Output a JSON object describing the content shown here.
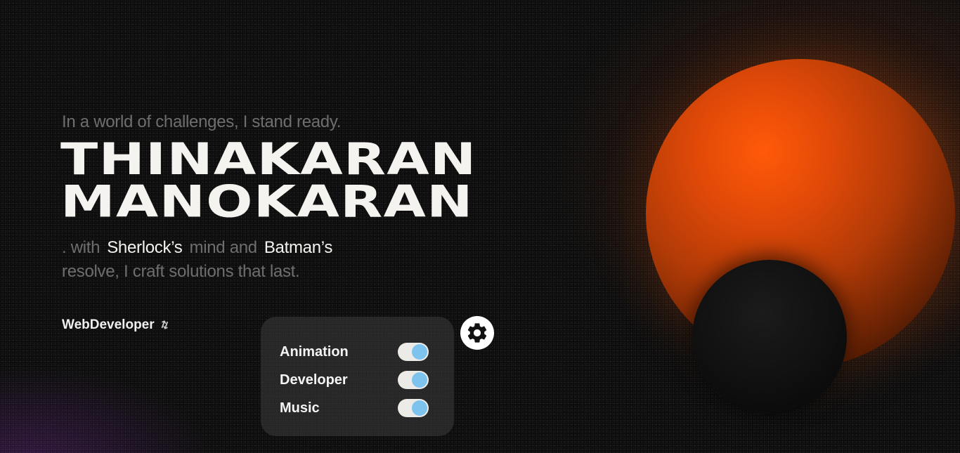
{
  "hero": {
    "tagline": "In a world of challenges, I stand ready.",
    "name_line1": "THINAKARAN",
    "name_line2": "MANOKARAN",
    "desc_prefix": ". with",
    "desc_hl1": "Sherlock’s",
    "desc_mid": "mind and",
    "desc_hl2": "Batman’s",
    "desc_suffix": "resolve, I craft solutions that last."
  },
  "role": {
    "label": "WebDeveloper",
    "swap_icon": "swap-arrows-icon"
  },
  "settings": {
    "gear_icon": "gear-icon",
    "options": [
      {
        "label": "Animation",
        "enabled": true
      },
      {
        "label": "Developer",
        "enabled": true
      },
      {
        "label": "Music",
        "enabled": true
      }
    ]
  },
  "colors": {
    "accent_orange": "#ff5a08",
    "toggle_knob": "#7ec3ee",
    "background": "#080808"
  }
}
